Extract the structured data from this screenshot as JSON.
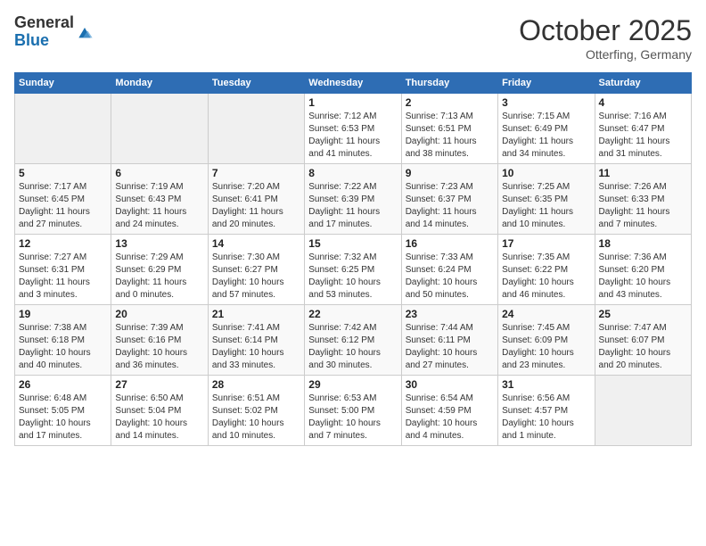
{
  "header": {
    "logo_general": "General",
    "logo_blue": "Blue",
    "month_title": "October 2025",
    "location": "Otterfing, Germany"
  },
  "weekdays": [
    "Sunday",
    "Monday",
    "Tuesday",
    "Wednesday",
    "Thursday",
    "Friday",
    "Saturday"
  ],
  "weeks": [
    [
      {
        "day": "",
        "info": ""
      },
      {
        "day": "",
        "info": ""
      },
      {
        "day": "",
        "info": ""
      },
      {
        "day": "1",
        "info": "Sunrise: 7:12 AM\nSunset: 6:53 PM\nDaylight: 11 hours\nand 41 minutes."
      },
      {
        "day": "2",
        "info": "Sunrise: 7:13 AM\nSunset: 6:51 PM\nDaylight: 11 hours\nand 38 minutes."
      },
      {
        "day": "3",
        "info": "Sunrise: 7:15 AM\nSunset: 6:49 PM\nDaylight: 11 hours\nand 34 minutes."
      },
      {
        "day": "4",
        "info": "Sunrise: 7:16 AM\nSunset: 6:47 PM\nDaylight: 11 hours\nand 31 minutes."
      }
    ],
    [
      {
        "day": "5",
        "info": "Sunrise: 7:17 AM\nSunset: 6:45 PM\nDaylight: 11 hours\nand 27 minutes."
      },
      {
        "day": "6",
        "info": "Sunrise: 7:19 AM\nSunset: 6:43 PM\nDaylight: 11 hours\nand 24 minutes."
      },
      {
        "day": "7",
        "info": "Sunrise: 7:20 AM\nSunset: 6:41 PM\nDaylight: 11 hours\nand 20 minutes."
      },
      {
        "day": "8",
        "info": "Sunrise: 7:22 AM\nSunset: 6:39 PM\nDaylight: 11 hours\nand 17 minutes."
      },
      {
        "day": "9",
        "info": "Sunrise: 7:23 AM\nSunset: 6:37 PM\nDaylight: 11 hours\nand 14 minutes."
      },
      {
        "day": "10",
        "info": "Sunrise: 7:25 AM\nSunset: 6:35 PM\nDaylight: 11 hours\nand 10 minutes."
      },
      {
        "day": "11",
        "info": "Sunrise: 7:26 AM\nSunset: 6:33 PM\nDaylight: 11 hours\nand 7 minutes."
      }
    ],
    [
      {
        "day": "12",
        "info": "Sunrise: 7:27 AM\nSunset: 6:31 PM\nDaylight: 11 hours\nand 3 minutes."
      },
      {
        "day": "13",
        "info": "Sunrise: 7:29 AM\nSunset: 6:29 PM\nDaylight: 11 hours\nand 0 minutes."
      },
      {
        "day": "14",
        "info": "Sunrise: 7:30 AM\nSunset: 6:27 PM\nDaylight: 10 hours\nand 57 minutes."
      },
      {
        "day": "15",
        "info": "Sunrise: 7:32 AM\nSunset: 6:25 PM\nDaylight: 10 hours\nand 53 minutes."
      },
      {
        "day": "16",
        "info": "Sunrise: 7:33 AM\nSunset: 6:24 PM\nDaylight: 10 hours\nand 50 minutes."
      },
      {
        "day": "17",
        "info": "Sunrise: 7:35 AM\nSunset: 6:22 PM\nDaylight: 10 hours\nand 46 minutes."
      },
      {
        "day": "18",
        "info": "Sunrise: 7:36 AM\nSunset: 6:20 PM\nDaylight: 10 hours\nand 43 minutes."
      }
    ],
    [
      {
        "day": "19",
        "info": "Sunrise: 7:38 AM\nSunset: 6:18 PM\nDaylight: 10 hours\nand 40 minutes."
      },
      {
        "day": "20",
        "info": "Sunrise: 7:39 AM\nSunset: 6:16 PM\nDaylight: 10 hours\nand 36 minutes."
      },
      {
        "day": "21",
        "info": "Sunrise: 7:41 AM\nSunset: 6:14 PM\nDaylight: 10 hours\nand 33 minutes."
      },
      {
        "day": "22",
        "info": "Sunrise: 7:42 AM\nSunset: 6:12 PM\nDaylight: 10 hours\nand 30 minutes."
      },
      {
        "day": "23",
        "info": "Sunrise: 7:44 AM\nSunset: 6:11 PM\nDaylight: 10 hours\nand 27 minutes."
      },
      {
        "day": "24",
        "info": "Sunrise: 7:45 AM\nSunset: 6:09 PM\nDaylight: 10 hours\nand 23 minutes."
      },
      {
        "day": "25",
        "info": "Sunrise: 7:47 AM\nSunset: 6:07 PM\nDaylight: 10 hours\nand 20 minutes."
      }
    ],
    [
      {
        "day": "26",
        "info": "Sunrise: 6:48 AM\nSunset: 5:05 PM\nDaylight: 10 hours\nand 17 minutes."
      },
      {
        "day": "27",
        "info": "Sunrise: 6:50 AM\nSunset: 5:04 PM\nDaylight: 10 hours\nand 14 minutes."
      },
      {
        "day": "28",
        "info": "Sunrise: 6:51 AM\nSunset: 5:02 PM\nDaylight: 10 hours\nand 10 minutes."
      },
      {
        "day": "29",
        "info": "Sunrise: 6:53 AM\nSunset: 5:00 PM\nDaylight: 10 hours\nand 7 minutes."
      },
      {
        "day": "30",
        "info": "Sunrise: 6:54 AM\nSunset: 4:59 PM\nDaylight: 10 hours\nand 4 minutes."
      },
      {
        "day": "31",
        "info": "Sunrise: 6:56 AM\nSunset: 4:57 PM\nDaylight: 10 hours\nand 1 minute."
      },
      {
        "day": "",
        "info": ""
      }
    ]
  ]
}
